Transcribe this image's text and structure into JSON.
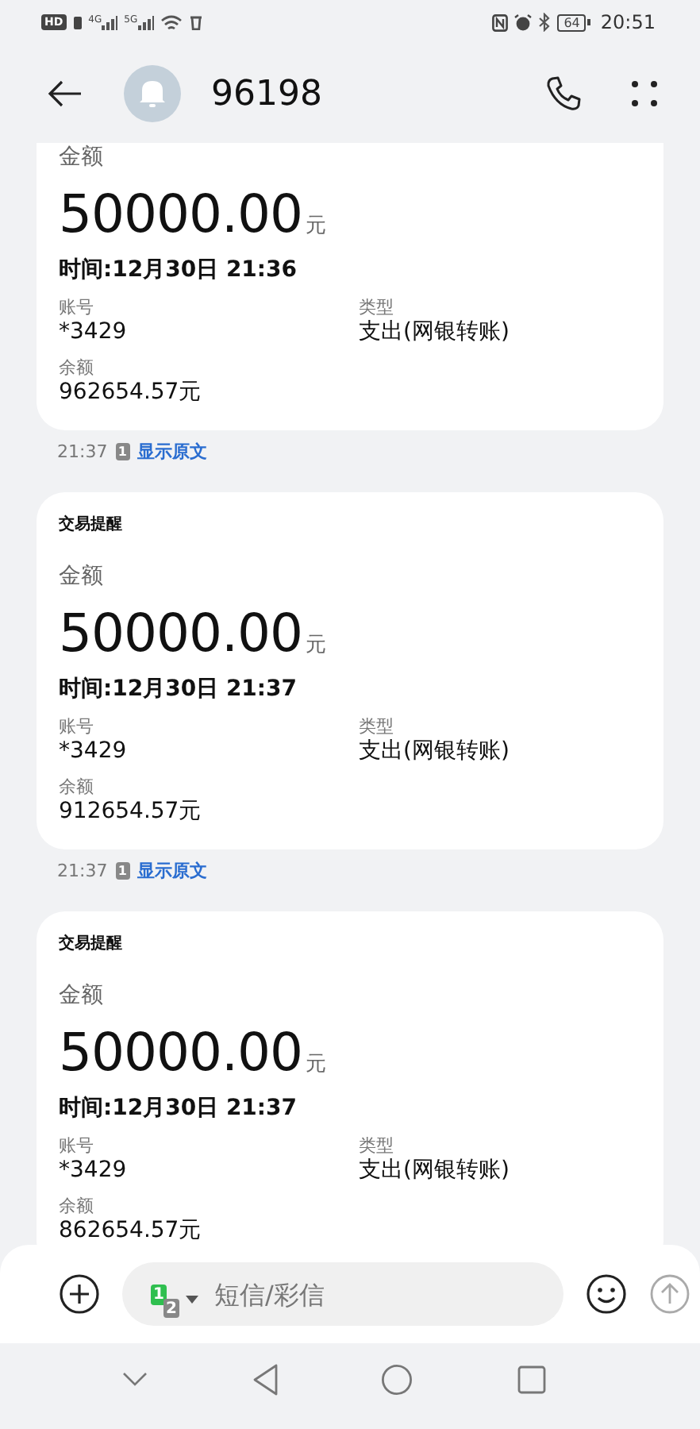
{
  "status_bar": {
    "hd": "HD",
    "networks": [
      "4G",
      "5G"
    ],
    "battery": "64",
    "time": "20:51"
  },
  "header": {
    "title": "96198"
  },
  "messages": [
    {
      "amount_label": "金额",
      "amount": "50000.00",
      "unit": "元",
      "time": "时间:12月30日 21:36",
      "fields": [
        {
          "label": "账号",
          "value": "*3429"
        },
        {
          "label": "类型",
          "value": "支出(网银转账)"
        },
        {
          "label": "余额",
          "value": "962654.57元"
        }
      ],
      "sent": "21:37",
      "sim": "1",
      "link": "显示原文"
    },
    {
      "title": "交易提醒",
      "amount_label": "金额",
      "amount": "50000.00",
      "unit": "元",
      "time": "时间:12月30日 21:37",
      "fields": [
        {
          "label": "账号",
          "value": "*3429"
        },
        {
          "label": "类型",
          "value": "支出(网银转账)"
        },
        {
          "label": "余额",
          "value": "912654.57元"
        }
      ],
      "sent": "21:37",
      "sim": "1",
      "link": "显示原文"
    },
    {
      "title": "交易提醒",
      "amount_label": "金额",
      "amount": "50000.00",
      "unit": "元",
      "time": "时间:12月30日 21:37",
      "fields": [
        {
          "label": "账号",
          "value": "*3429"
        },
        {
          "label": "类型",
          "value": "支出(网银转账)"
        },
        {
          "label": "余额",
          "value": "862654.57元"
        }
      ]
    }
  ],
  "composer": {
    "sims": [
      {
        "label": "1",
        "selected": true
      },
      {
        "label": "2",
        "selected": false
      }
    ],
    "placeholder": "短信/彩信"
  }
}
